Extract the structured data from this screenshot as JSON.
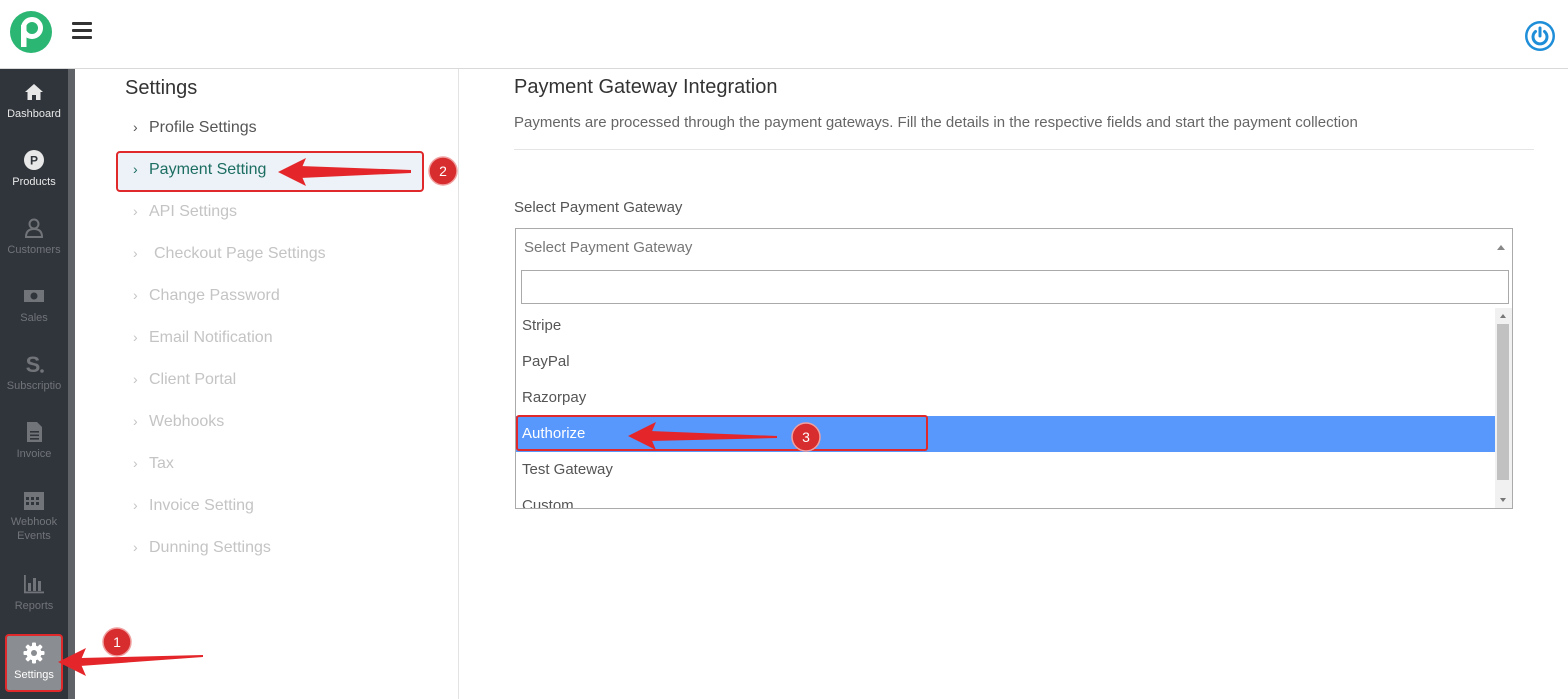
{
  "colors": {
    "brand": "#2bb673",
    "sidebar_bg": "#30353b",
    "active_menu_text": "#1c6d62",
    "highlight_option": "#5897fb",
    "annotation_red": "#e0292b",
    "power_button": "#1f8ed8"
  },
  "header": {
    "logo_icon": "brand-p-logo",
    "menu_icon": "hamburger-icon",
    "power_icon": "power-icon"
  },
  "sidebar": {
    "items": [
      {
        "label": "Dashboard",
        "icon": "home-icon"
      },
      {
        "label": "Products",
        "icon": "product-p-icon"
      },
      {
        "label": "Customers",
        "icon": "user-icon"
      },
      {
        "label": "Sales",
        "icon": "money-icon"
      },
      {
        "label": "Subscriptio",
        "icon": "subscription-s-icon"
      },
      {
        "label": "Invoice",
        "icon": "document-icon"
      },
      {
        "label": "Webhook Events",
        "icon": "calendar-icon"
      },
      {
        "label": "Reports",
        "icon": "bar-chart-icon"
      },
      {
        "label": "Settings",
        "icon": "gear-icon"
      }
    ]
  },
  "settings_menu": {
    "title": "Settings",
    "items": [
      {
        "label": "Profile Settings"
      },
      {
        "label": "Payment Setting"
      },
      {
        "label": "API Settings"
      },
      {
        "label": "Checkout Page Settings"
      },
      {
        "label": "Change Password"
      },
      {
        "label": "Email Notification"
      },
      {
        "label": "Client Portal"
      },
      {
        "label": "Webhooks"
      },
      {
        "label": "Tax"
      },
      {
        "label": "Invoice Setting"
      },
      {
        "label": "Dunning Settings"
      }
    ]
  },
  "main": {
    "title": "Payment Gateway Integration",
    "description": "Payments are processed through the payment gateways. Fill the details in the respective fields and start the payment collection",
    "gateway_label": "Select Payment Gateway",
    "gateway_placeholder": "Select Payment Gateway",
    "search_value": "",
    "options": [
      "Stripe",
      "PayPal",
      "Razorpay",
      "Authorize",
      "Test Gateway",
      "Custom"
    ],
    "highlighted_option": "Authorize"
  },
  "annotations": {
    "badges": [
      "1",
      "2",
      "3"
    ]
  }
}
